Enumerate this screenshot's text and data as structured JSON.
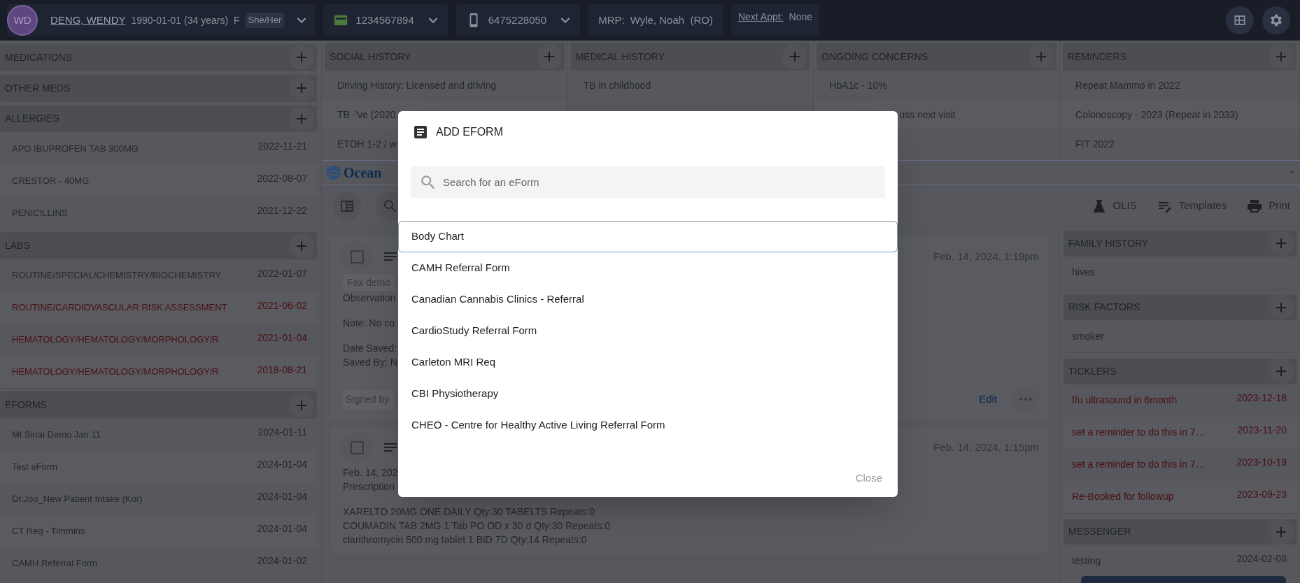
{
  "patient_bar": {
    "initials": "WD",
    "name": "DENG, WENDY",
    "dob": "1990-01-01 (34 years)",
    "sex": "F",
    "pronouns": "She/Her",
    "health_card": "1234567894",
    "phone": "6475228050",
    "mrp_label": "MRP:",
    "mrp": "Wyle, Noah  (RO)",
    "next_appt_label": "Next Appt:",
    "next_appt": "None"
  },
  "left_sections": [
    {
      "title": "MEDICATIONS"
    },
    {
      "title": "OTHER MEDS"
    },
    {
      "title": "ALLERGIES",
      "items": [
        {
          "label": "APO IBUPROFEN TAB 300MG",
          "date": "2022-11-21",
          "flagged": false
        },
        {
          "label": "CRESTOR - 40MG",
          "date": "2022-08-07",
          "flagged": false
        },
        {
          "label": "PENICILLINS",
          "date": "2021-12-22",
          "flagged": false
        }
      ]
    },
    {
      "title": "LABS",
      "items": [
        {
          "label": "ROUTINE/SPECIAL/CHEMISTRY/BIOCHEMISTRY",
          "date": "2022-01-07",
          "flagged": false
        },
        {
          "label": "ROUTINE/CARDIOVASCULAR RISK ASSESSMENT",
          "date": "2021-06-02",
          "flagged": true
        },
        {
          "label": "HEMATOLOGY/HEMATOLOGY/MORPHOLOGY/R",
          "date": "2021-01-04",
          "flagged": true
        },
        {
          "label": "HEMATOLOGY/HEMATOLOGY/MORPHOLOGY/R",
          "date": "2018-08-21",
          "flagged": true
        }
      ]
    },
    {
      "title": "EFORMS",
      "items": [
        {
          "label": "Mt Sinai Demo Jan 11",
          "date": "2024-01-11",
          "flagged": false
        },
        {
          "label": "Test eForm",
          "date": "2024-01-04",
          "flagged": false
        },
        {
          "label": "Dr.Joo_New Patient Intake (Kor)",
          "date": "2024-01-04",
          "flagged": false
        },
        {
          "label": "CT Req - Timmins",
          "date": "2024-01-04",
          "flagged": false
        },
        {
          "label": "CAMH Referral Form",
          "date": "2024-01-02",
          "flagged": false
        }
      ]
    }
  ],
  "top_sections": [
    {
      "title": "SOCIAL HISTORY",
      "items": [
        {
          "kind": "text",
          "label": "Driving History: Licensed and driving"
        },
        {
          "kind": "text",
          "label": "TB -'ve (2020"
        },
        {
          "kind": "text",
          "label": "ETOH 1-2 / w"
        }
      ]
    },
    {
      "title": "MEDICAL HISTORY",
      "items": [
        {
          "kind": "text",
          "label": "TB in childhood"
        }
      ]
    },
    {
      "title": "ONGOING CONCERNS",
      "items": [
        {
          "kind": "text",
          "label": "HbA1c - 10%"
        },
        {
          "kind": "tail",
          "label": "uss next visit"
        }
      ]
    },
    {
      "title": "REMINDERS",
      "items": [
        {
          "kind": "text",
          "label": "Repeat Mammo in 2022"
        },
        {
          "kind": "text",
          "label": "Colonoscopy - 2023 (Repeat in 2033)"
        },
        {
          "kind": "text",
          "label": "FIT 2022"
        }
      ]
    }
  ],
  "ocean_bar": {
    "label": "Ocean"
  },
  "toolbar": {
    "buttons": [
      "OLIS",
      "Templates",
      "Print"
    ]
  },
  "notes": [
    {
      "checked": false,
      "date": "Feb. 14, 2024, 1:19pm",
      "tag": "Fax demo",
      "blocks": [
        [
          "Observation"
        ],
        [
          "Note: No co"
        ],
        [
          "Date Saved:",
          "Saved By: N"
        ]
      ],
      "signature": "Signed by",
      "action": "Edit"
    },
    {
      "checked": false,
      "date": "Feb. 14, 2024, 1:15pm",
      "blocks": [
        [
          "Feb. 14, 202",
          "Prescription"
        ],
        [
          "XARELTO 20MG ONE DAILY Qty:30 TABELTS Repeats:0",
          "COUMADIN TAB 2MG 1 Tab PO OD x 30 d Qty:30 Repeats:0",
          "clarithromycin 500 mg tablet 1 BID 7D Qty:14 Repeats:0"
        ]
      ]
    }
  ],
  "right_sections": [
    {
      "title": "FAMILY HISTORY",
      "items": [
        {
          "label": "hives",
          "flagged": false
        }
      ]
    },
    {
      "title": "RISK FACTORS",
      "items": [
        {
          "label": "smoker",
          "flagged": false
        }
      ]
    },
    {
      "title": "TICKLERS",
      "items": [
        {
          "label": "f/u ultrasound in 6month",
          "date": "2023-12-18",
          "flagged": true
        },
        {
          "label": "set a reminder to do this in 7…",
          "date": "2023-11-20",
          "flagged": true
        },
        {
          "label": "set a reminder to do this in 7…",
          "date": "2023-10-19",
          "flagged": true
        },
        {
          "label": "Re-Booked for followup",
          "date": "2023-09-23",
          "flagged": true
        }
      ]
    },
    {
      "title": "MESSENGER",
      "items": [
        {
          "label": "testing",
          "date": "2024-02-08",
          "flagged": false
        }
      ]
    }
  ],
  "modal": {
    "title": "ADD EFORM",
    "search": {
      "placeholder": "Search for an eForm"
    },
    "items": [
      {
        "label": "Body Chart",
        "selected": true
      },
      {
        "label": "CAMH Referral Form",
        "selected": false
      },
      {
        "label": "Canadian Cannabis Clinics - Referral",
        "selected": false
      },
      {
        "label": "CardioStudy Referral Form",
        "selected": false
      },
      {
        "label": "Carleton MRI Req",
        "selected": false
      },
      {
        "label": "CBI Physiotherapy",
        "selected": false
      },
      {
        "label": "CHEO - Centre for Healthy Active Living Referral Form",
        "selected": false
      }
    ],
    "close": "Close"
  }
}
